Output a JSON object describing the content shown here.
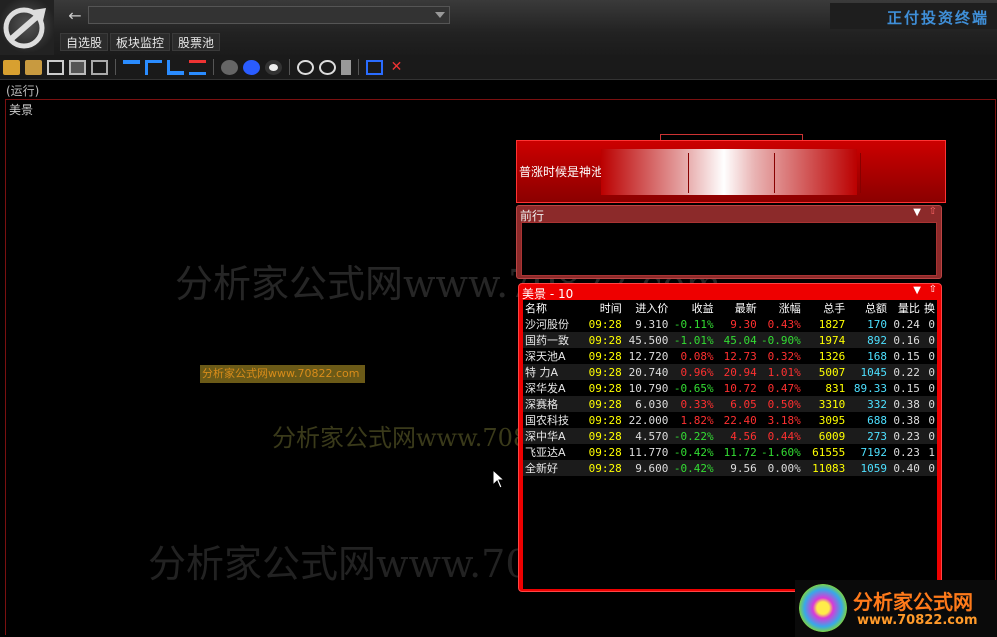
{
  "app": {
    "brand": "正付投资终端"
  },
  "menu": [
    "自选股",
    "板块监控",
    "股票池"
  ],
  "status": "(运行)",
  "main_title": "美景",
  "header_widget": {
    "label": "普涨时候是神池"
  },
  "panel_qianxing": {
    "title": "前行"
  },
  "panel_meijing": {
    "title": "美景 - 10",
    "columns": [
      "名称",
      "时间",
      "进入价",
      "收益",
      "最新",
      "涨幅",
      "总手",
      "总额",
      "量比",
      "换"
    ],
    "rows": [
      [
        "沙河股份",
        "09:28",
        "9.310",
        "-0.11%",
        "9.30",
        "0.43%",
        "1827",
        "170",
        "0.24",
        "0"
      ],
      [
        "国药一致",
        "09:28",
        "45.500",
        "-1.01%",
        "45.04",
        "-0.90%",
        "1974",
        "892",
        "0.16",
        "0"
      ],
      [
        "深天池A",
        "09:28",
        "12.720",
        "0.08%",
        "12.73",
        "0.32%",
        "1326",
        "168",
        "0.15",
        "0"
      ],
      [
        "特 力A",
        "09:28",
        "20.740",
        "0.96%",
        "20.94",
        "1.01%",
        "5007",
        "1045",
        "0.22",
        "0"
      ],
      [
        "深华发A",
        "09:28",
        "10.790",
        "-0.65%",
        "10.72",
        "0.47%",
        "831",
        "89.33",
        "0.15",
        "0"
      ],
      [
        "深赛格",
        "09:28",
        "6.030",
        "0.33%",
        "6.05",
        "0.50%",
        "3310",
        "332",
        "0.38",
        "0"
      ],
      [
        "国农科技",
        "09:28",
        "22.000",
        "1.82%",
        "22.40",
        "3.18%",
        "3095",
        "688",
        "0.38",
        "0"
      ],
      [
        "深中华A",
        "09:28",
        "4.570",
        "-0.22%",
        "4.56",
        "0.44%",
        "6009",
        "273",
        "0.23",
        "0"
      ],
      [
        "飞亚达A",
        "09:28",
        "11.770",
        "-0.42%",
        "11.72",
        "-1.60%",
        "61555",
        "7192",
        "0.23",
        "1"
      ],
      [
        "全新好",
        "09:28",
        "9.600",
        "-0.42%",
        "9.56",
        "0.00%",
        "11083",
        "1059",
        "0.40",
        "0"
      ]
    ]
  },
  "watermarks": {
    "wm1": "分析家公式网www.70822.com",
    "wm2": "分析家公式网www.70822.com",
    "wm3": "分析家公式网www.70822.com",
    "wm_box": "分析家公式网www.70822.com"
  },
  "bottom_logo": {
    "title": "分析家公式网",
    "url": "www.70822.com"
  },
  "colors": {
    "accent_red": "#e00000",
    "up": "#ff3030",
    "down": "#33dd33",
    "brand_blue": "#3f8fd8"
  }
}
